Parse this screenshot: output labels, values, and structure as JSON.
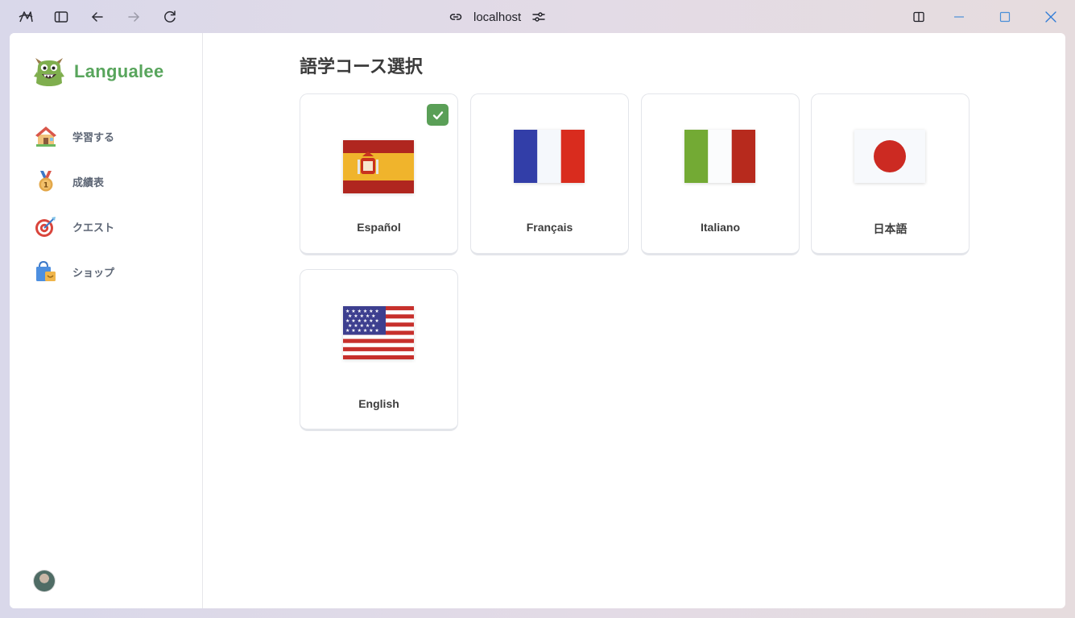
{
  "browser": {
    "url": "localhost",
    "colors": {
      "chrome_text": "#2b2b33",
      "close_x": "#2e7bd6"
    }
  },
  "sidebar": {
    "brand_name": "Langualee",
    "brand_color": "#58a55c",
    "items": [
      {
        "label": "学習する",
        "icon": "house-icon"
      },
      {
        "label": "成績表",
        "icon": "medal-icon"
      },
      {
        "label": "クエスト",
        "icon": "target-icon"
      },
      {
        "label": "ショップ",
        "icon": "shopping-bag-icon"
      }
    ]
  },
  "main": {
    "title": "語学コース選択",
    "courses": [
      {
        "label": "Español",
        "flag": "spain-flag-icon",
        "selected": true
      },
      {
        "label": "Français",
        "flag": "france-flag-icon",
        "selected": false
      },
      {
        "label": "Italiano",
        "flag": "italy-flag-icon",
        "selected": false
      },
      {
        "label": "日本語",
        "flag": "japan-flag-icon",
        "selected": false
      },
      {
        "label": "English",
        "flag": "usa-flag-icon",
        "selected": false
      }
    ],
    "selected_color": "#5a9f57"
  }
}
